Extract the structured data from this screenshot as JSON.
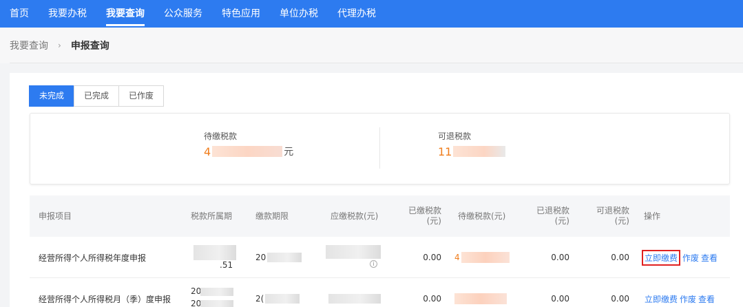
{
  "topnav": {
    "items": [
      {
        "label": "首页",
        "active": false
      },
      {
        "label": "我要办税",
        "active": false
      },
      {
        "label": "我要查询",
        "active": true
      },
      {
        "label": "公众服务",
        "active": false
      },
      {
        "label": "特色应用",
        "active": false
      },
      {
        "label": "单位办税",
        "active": false
      },
      {
        "label": "代理办税",
        "active": false
      }
    ],
    "bg_color": "#2d7bf0"
  },
  "breadcrumb": {
    "parent": "我要查询",
    "separator": "›",
    "current": "申报查询"
  },
  "tabs": [
    {
      "label": "未完成",
      "active": true
    },
    {
      "label": "已完成",
      "active": false
    },
    {
      "label": "已作废",
      "active": false
    }
  ],
  "summary": {
    "pending": {
      "label": "待缴税款",
      "amount_visible_prefix": "4",
      "unit": "元"
    },
    "refundable": {
      "label": "可退税款",
      "amount_visible_prefix": "11"
    }
  },
  "table": {
    "headers": {
      "item": "申报项目",
      "period": "税款所属期",
      "deadline": "缴款期限",
      "payable": "应缴税款(元)",
      "paid_l1": "已缴税款",
      "paid_l2": "(元)",
      "pending": "待缴税款(元)",
      "refunded_l1": "已退税款",
      "refunded_l2": "(元)",
      "refundable_l1": "可退税款",
      "refundable_l2": "(元)",
      "ops": "操作"
    },
    "rows": [
      {
        "item": "经营所得个人所得税年度申报",
        "period_fragment": ".51",
        "deadline_prefix": "20",
        "paid": "0.00",
        "pending_prefix": "4",
        "refunded": "0.00",
        "refundable": "0.00",
        "op_pay": "立即缴费",
        "op_void": "作废",
        "op_view": "查看"
      },
      {
        "item": "经营所得个人所得税月（季）度申报",
        "period_fragment_top": "20",
        "period_fragment_bottom": "20",
        "deadline_prefix": "2(",
        "paid": "0.00",
        "refunded": "0.00",
        "refundable": "0.00",
        "op_pay": "立即缴费",
        "op_void": "作废",
        "op_view": "查看"
      }
    ]
  },
  "colors": {
    "accent": "#2d7bf0",
    "amount": "#f07d1c",
    "highlight_border": "#e02020"
  }
}
